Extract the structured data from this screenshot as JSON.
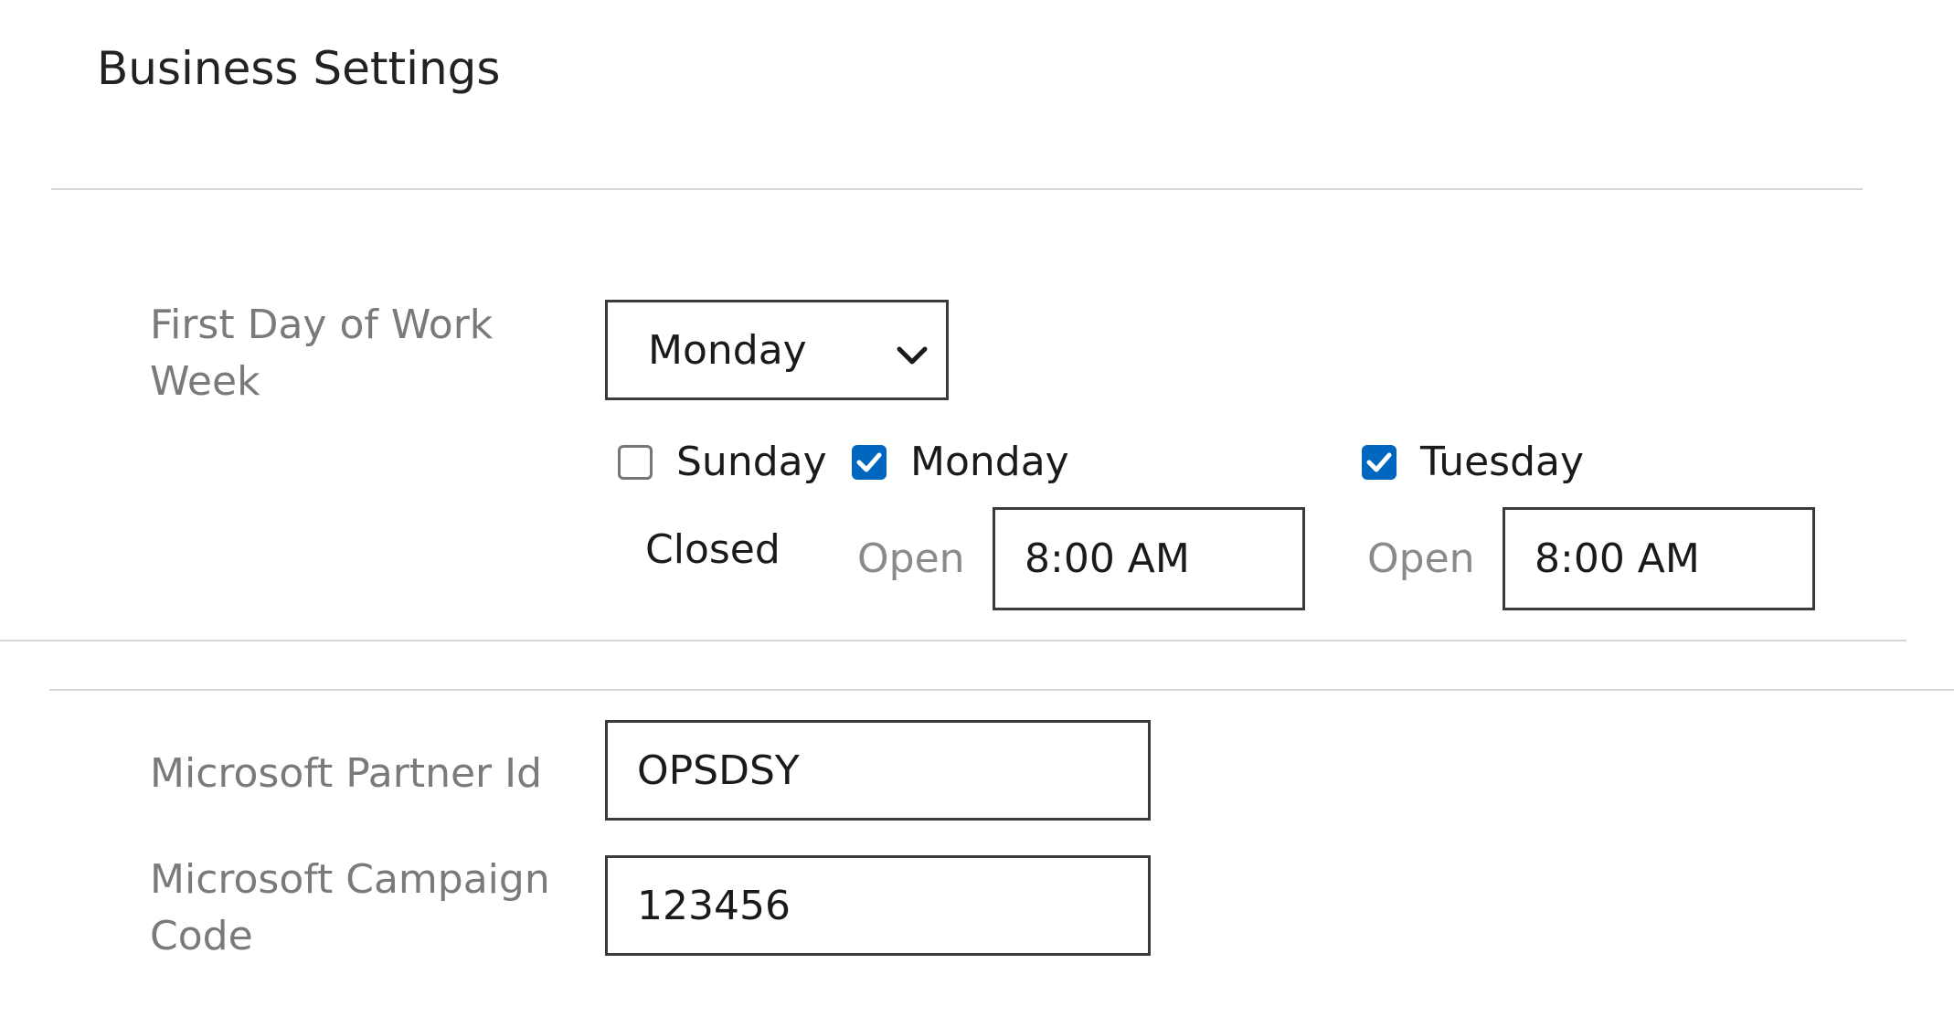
{
  "page": {
    "title": "Business Settings"
  },
  "work_week": {
    "first_day_label_line1": "First Day of Work",
    "first_day_label_line2": "Week",
    "first_day_value": "Monday",
    "days": [
      {
        "label": "Sunday",
        "checked": false,
        "status": "Closed"
      },
      {
        "label": "Monday",
        "checked": true,
        "open_label": "Open",
        "open_time": "8:00 AM"
      },
      {
        "label": "Tuesday",
        "checked": true,
        "open_label": "Open",
        "open_time": "8:00 AM"
      }
    ]
  },
  "partner": {
    "partner_id_label": "Microsoft Partner Id",
    "partner_id_value": "OPSDSY",
    "campaign_label_line1": "Microsoft Campaign",
    "campaign_label_line2": "Code",
    "campaign_value": "123456"
  },
  "colors": {
    "checkbox_accent": "#0067c0",
    "label_gray": "#7a7a7a",
    "divider": "#d6d6d6"
  },
  "icons": {
    "select_chevron": "chevron-down-icon",
    "checkmark": "checkmark-icon"
  }
}
